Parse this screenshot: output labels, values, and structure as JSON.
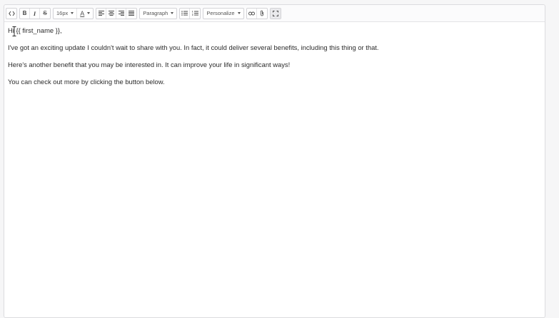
{
  "toolbar": {
    "font_size": "16px",
    "text_color_label": "A",
    "block_format": "Paragraph",
    "personalize": "Personalize"
  },
  "body": {
    "greeting": "Hi {{ first_name }},",
    "paragraphs": [
      "I've got an exciting update I couldn't wait to share with you. In fact, it could deliver several benefits, including this thing or that.",
      "Here's another benefit that you may be interested in. It can improve your life in significant ways!",
      "You can check out more by clicking the button below."
    ]
  },
  "colors": {
    "border": "#dcdcdf",
    "toolbar_bg": "#fbfbfc",
    "text": "#2c2c2c"
  }
}
